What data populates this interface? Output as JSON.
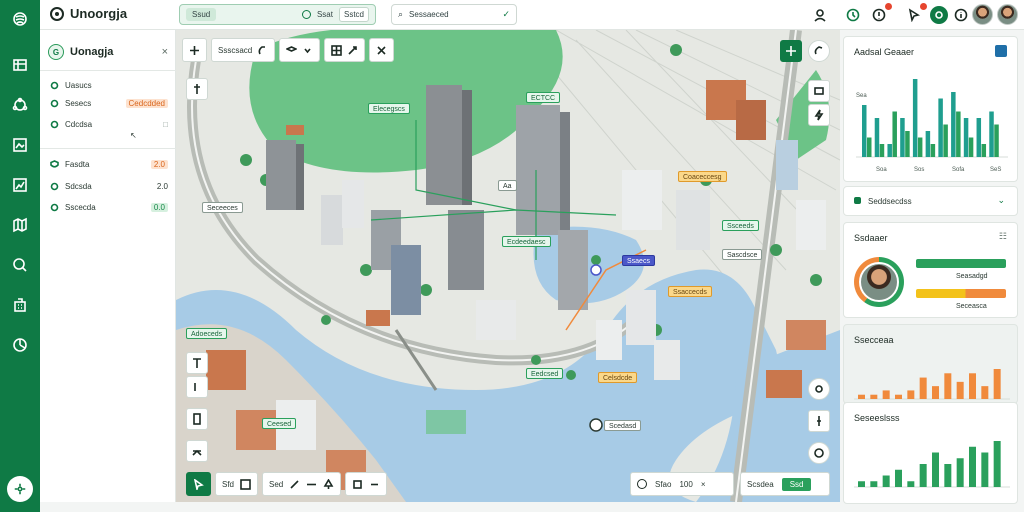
{
  "app": {
    "title": "Unoorgja"
  },
  "topbar": {
    "seg1_a": "Ssud",
    "seg1_b": "Ssat",
    "seg1_c": "Sstcd",
    "search_text": "Sessaeced",
    "icons": [
      "user-icon",
      "timer-icon",
      "alert-icon",
      "cursor-icon",
      "leaf-icon",
      "info-icon"
    ]
  },
  "sidepanel": {
    "title": "Uonagja",
    "rows": [
      {
        "label": "Uasucs",
        "value": ""
      },
      {
        "label": "Sesecs",
        "value": "Cedcdded"
      },
      {
        "label": "Cdcdsa",
        "value": ""
      },
      {
        "label": "Fasdta",
        "value": "2.0"
      },
      {
        "label": "Sdcsda",
        "value": "2.0"
      },
      {
        "label": "Sscecda",
        "value": "0.0"
      }
    ]
  },
  "map": {
    "toolbar": {
      "zoom_text": "Ssscsacd"
    },
    "labels": {
      "l1": "Elecegscs",
      "l2": "Coaceccesg",
      "l3": "Ecdeedaesc",
      "l4": "Ssceeds",
      "l5": "Aa",
      "l6": "Sascdsce",
      "l7": "Ssaccecds",
      "l8": "Adoeceds",
      "l9": "Eedcsed",
      "l10": "Ceesed",
      "l11": "Celsdcde",
      "l12": "Ssaecs",
      "l13": "Scedasd",
      "l14": "Seceeces",
      "l15": "ECTCC"
    },
    "bottombar": {
      "item1": "Sfd",
      "item2": "Sed"
    },
    "zoombar": {
      "text": "Sfao",
      "value": "100"
    },
    "layerbar": {
      "text": "Scsdea",
      "button": "Ssd"
    }
  },
  "rightpanel": {
    "card1": {
      "title": "Aadsal Geaaer",
      "ticks": [
        "Soa",
        "Sos",
        "Sofa",
        "SeS"
      ],
      "label_a": "Sea"
    },
    "card1_footer": "Seddsecdss",
    "card2": {
      "title": "Ssdaaer",
      "bar1_label": "Seasadgd",
      "bar2_label": "Seceasca"
    },
    "card3": {
      "title": "Ssecceaa"
    },
    "card4": {
      "title": "Seseeslsss"
    }
  },
  "chart_data": [
    {
      "type": "bar",
      "series": [
        {
          "values": [
            8,
            6,
            2,
            6,
            12,
            4,
            9,
            10,
            6,
            6,
            7
          ]
        },
        {
          "values": [
            3,
            2,
            7,
            4,
            3,
            2,
            5,
            7,
            3,
            2,
            5
          ]
        }
      ],
      "colors": [
        "#1f9e8f",
        "#2aa05c"
      ]
    },
    {
      "type": "bar",
      "values": [
        1,
        1,
        2,
        1,
        2,
        5,
        3,
        6,
        4,
        6,
        3,
        7
      ],
      "colors": [
        "#f08a3c"
      ]
    },
    {
      "type": "bar",
      "values": [
        1,
        1,
        2,
        3,
        1,
        4,
        6,
        4,
        5,
        7,
        6,
        8
      ],
      "colors": [
        "#2aa05c"
      ]
    }
  ],
  "colors": {
    "brand": "#0f7a45",
    "accent_orange": "#f08a3c",
    "accent_green": "#2aa05c",
    "water": "#a7cbe6"
  }
}
